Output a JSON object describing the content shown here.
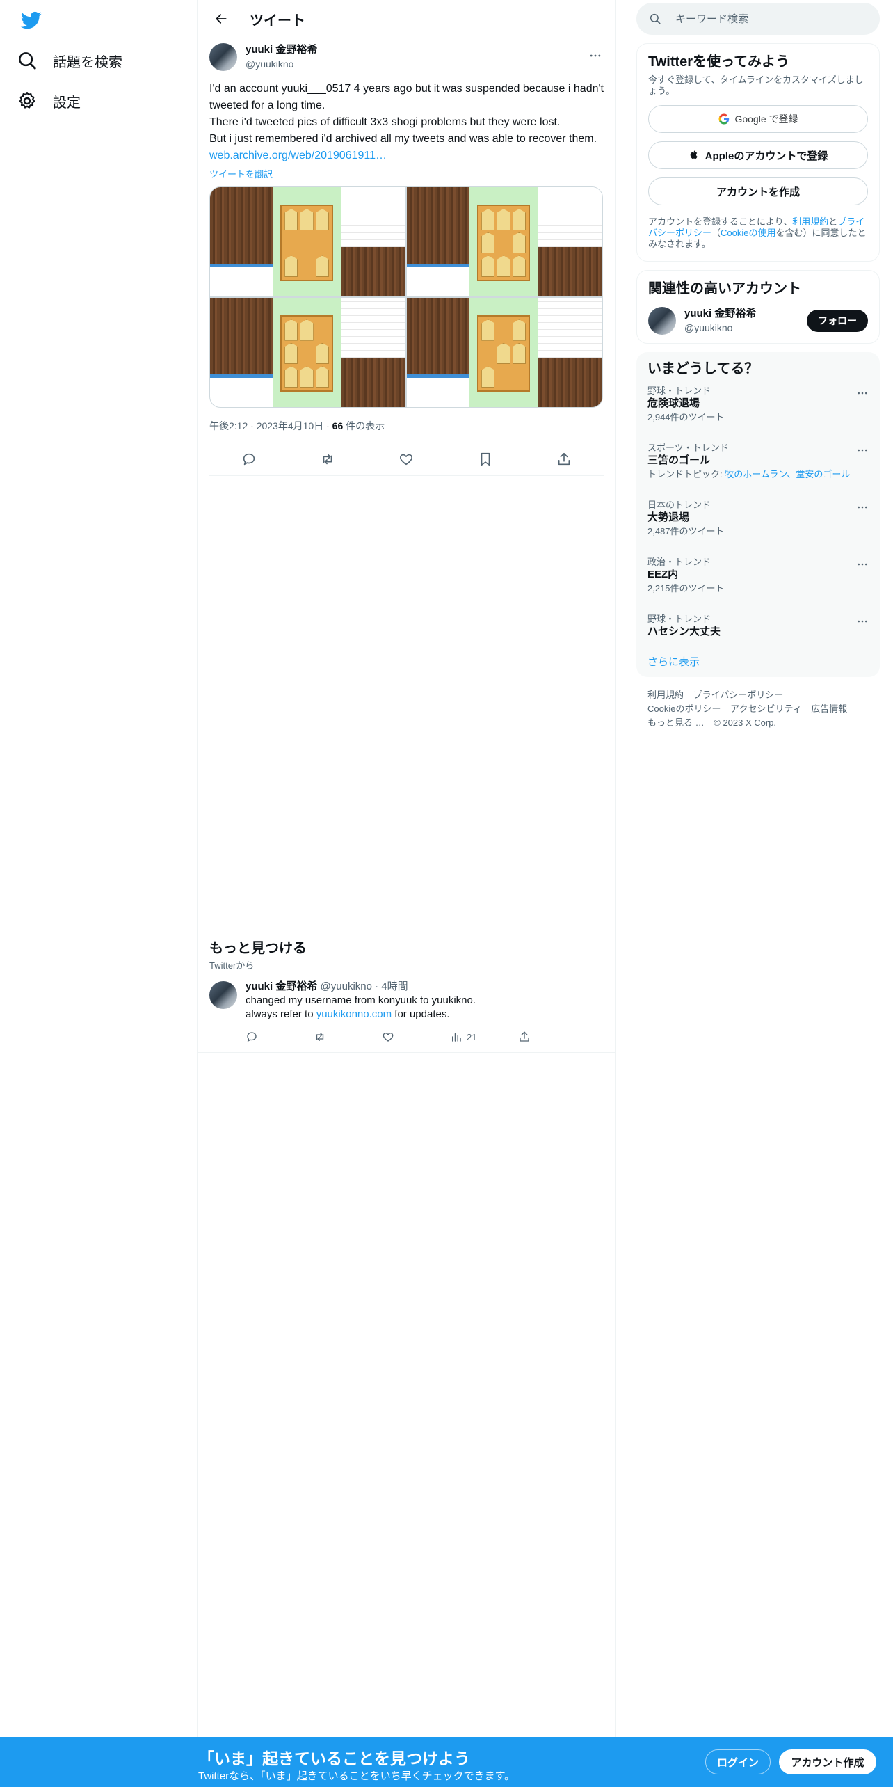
{
  "nav": {
    "logo_icon": "twitter-bird-icon",
    "items": [
      {
        "label": "話題を検索",
        "icon": "search-icon"
      },
      {
        "label": "設定",
        "icon": "gear-icon"
      }
    ]
  },
  "header": {
    "title": "ツイート"
  },
  "tweet": {
    "author_name": "yuuki 金野裕希",
    "author_handle": "@yuukikno",
    "text_lines": [
      "I'd an account yuuki___0517 4 years ago but it was suspended because i hadn't tweeted for a long time.",
      "There i'd tweeted pics of difficult 3x3 shogi problems but they were lost.",
      "But i just remembered i'd archived all my tweets and was able to recover them."
    ],
    "link": "web.archive.org/web/2019061911…",
    "translate": "ツイートを翻訳",
    "time": "午後2:12",
    "date": "2023年4月10日",
    "views_count": "66",
    "views_label": " 件の表示"
  },
  "more_section": {
    "title": "もっと見つける",
    "subtitle": "Twitterから",
    "tweet": {
      "author_name": "yuuki 金野裕希",
      "author_handle": "@yuukikno",
      "time": "4時間",
      "line1": "changed my username from konyuuk to yuukikno.",
      "line2_pre": "always refer to ",
      "line2_link": "yuukikonno.com",
      "line2_post": " for updates.",
      "views": "21"
    }
  },
  "search": {
    "placeholder": "キーワード検索"
  },
  "signup_card": {
    "title": "Twitterを使ってみよう",
    "desc": "今すぐ登録して、タイムラインをカスタマイズしましょう。",
    "google": "Google で登録",
    "apple": "Appleのアカウントで登録",
    "create": "アカウントを作成",
    "legal_pre": "アカウントを登録することにより、",
    "legal_terms": "利用規約",
    "legal_and": "と",
    "legal_privacy": "プライバシーポリシー",
    "legal_mid": "（",
    "legal_cookie": "Cookieの使用",
    "legal_post": "を含む）に同意したとみなされます。"
  },
  "related": {
    "title": "関連性の高いアカウント",
    "name": "yuuki 金野裕希",
    "handle": "@yuukikno",
    "follow": "フォロー"
  },
  "trends": {
    "title": "いまどうしてる？",
    "items": [
      {
        "context": "野球・トレンド",
        "name": "危険球退場",
        "count": "2,944件のツイート"
      },
      {
        "context": "スポーツ・トレンド",
        "name": "三笘のゴール",
        "topic_pre": "トレンドトピック: ",
        "topic_links": "牧のホームラン、堂安のゴール"
      },
      {
        "context": "日本のトレンド",
        "name": "大勢退場",
        "count": "2,487件のツイート"
      },
      {
        "context": "政治・トレンド",
        "name": "EEZ内",
        "count": "2,215件のツイート"
      },
      {
        "context": "野球・トレンド",
        "name": "ハセシン大丈夫"
      }
    ],
    "show_more": "さらに表示"
  },
  "footer": {
    "links": [
      "利用規約",
      "プライバシーポリシー",
      "Cookieのポリシー",
      "アクセシビリティ",
      "広告情報",
      "もっと見る …",
      "© 2023 X Corp."
    ]
  },
  "bottom_bar": {
    "title": "「いま」起きていることを見つけよう",
    "subtitle": "Twitterなら、「いま」起きていることをいち早くチェックできます。",
    "login": "ログイン",
    "signup": "アカウント作成"
  },
  "colors": {
    "accent": "#1d9bf0",
    "text": "#0f1419",
    "muted": "#536471"
  }
}
